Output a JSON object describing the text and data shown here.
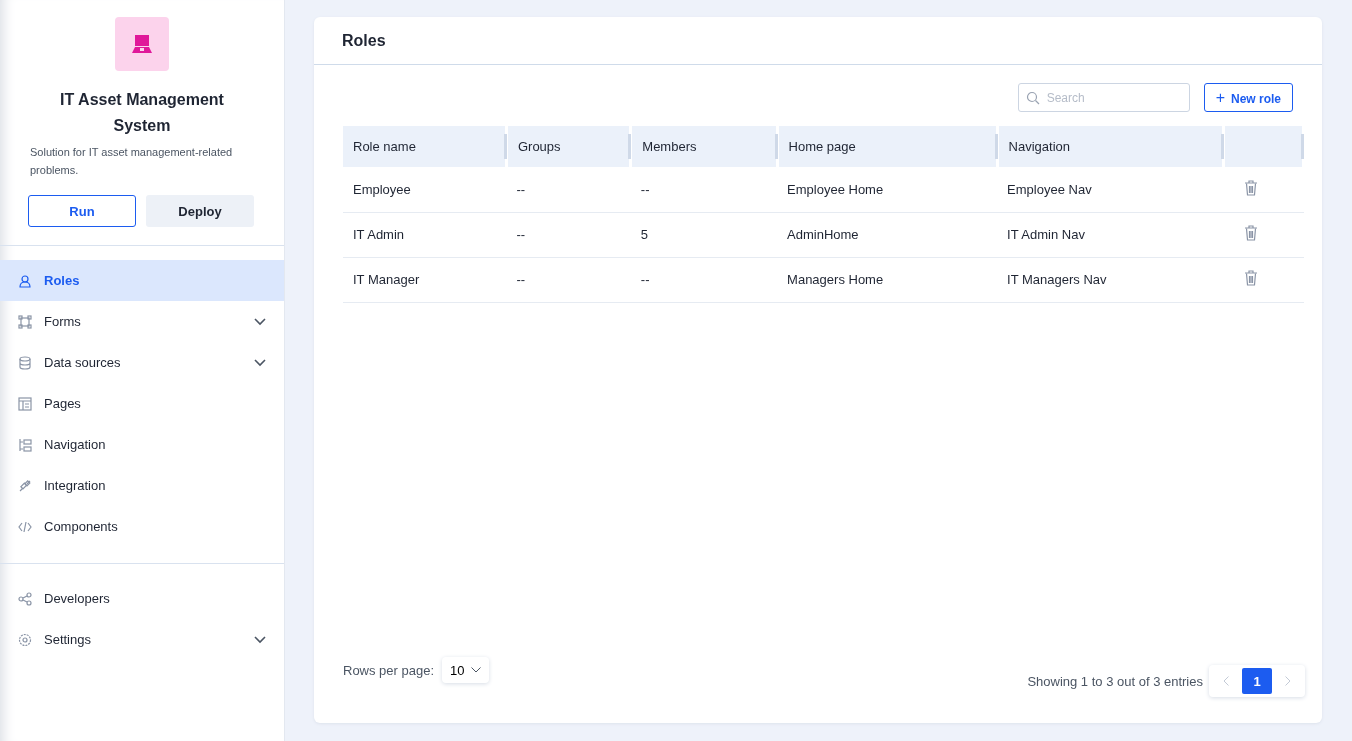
{
  "app": {
    "title": "IT Asset Management System",
    "description": "Solution for IT asset management-related problems.",
    "buttons": [
      {
        "label": "Run",
        "kind": "outline"
      },
      {
        "label": "Deploy",
        "kind": "soft"
      }
    ]
  },
  "sidebar": {
    "items": [
      {
        "label": "Roles",
        "selected": true,
        "kind": "link"
      },
      {
        "label": "Forms",
        "selected": false,
        "kind": "group"
      },
      {
        "label": "Data sources",
        "selected": false,
        "kind": "group"
      },
      {
        "label": "Pages",
        "selected": false,
        "kind": "link"
      },
      {
        "label": "Navigation",
        "selected": false,
        "kind": "link"
      },
      {
        "label": "Integration",
        "selected": false,
        "kind": "link"
      },
      {
        "label": "Components",
        "selected": false,
        "kind": "link"
      }
    ],
    "footer_items": [
      {
        "label": "Developers",
        "selected": false,
        "kind": "link"
      },
      {
        "label": "Settings",
        "selected": false,
        "kind": "group"
      }
    ]
  },
  "panel": {
    "title": "Roles",
    "search": {
      "placeholder": "Search"
    },
    "new_button": {
      "label": "New role",
      "icon": "+"
    },
    "table": {
      "columns": [
        "Role name",
        "Groups",
        "Members",
        "Home page",
        "Navigation"
      ],
      "rows": [
        [
          "Employee",
          "--",
          "--",
          "Employee Home",
          "Employee Nav"
        ],
        [
          "IT Admin",
          "--",
          "5",
          "AdminHome",
          "IT Admin Nav"
        ],
        [
          "IT Manager",
          "--",
          "--",
          "Managers Home",
          "IT Managers Nav"
        ]
      ]
    },
    "footer": {
      "rows_label": "Rows per page:",
      "rows_value": "10",
      "summary": "Showing 1 to 3 out of 3 entries",
      "pages": [
        {
          "label": "1",
          "selected": true
        }
      ]
    }
  }
}
